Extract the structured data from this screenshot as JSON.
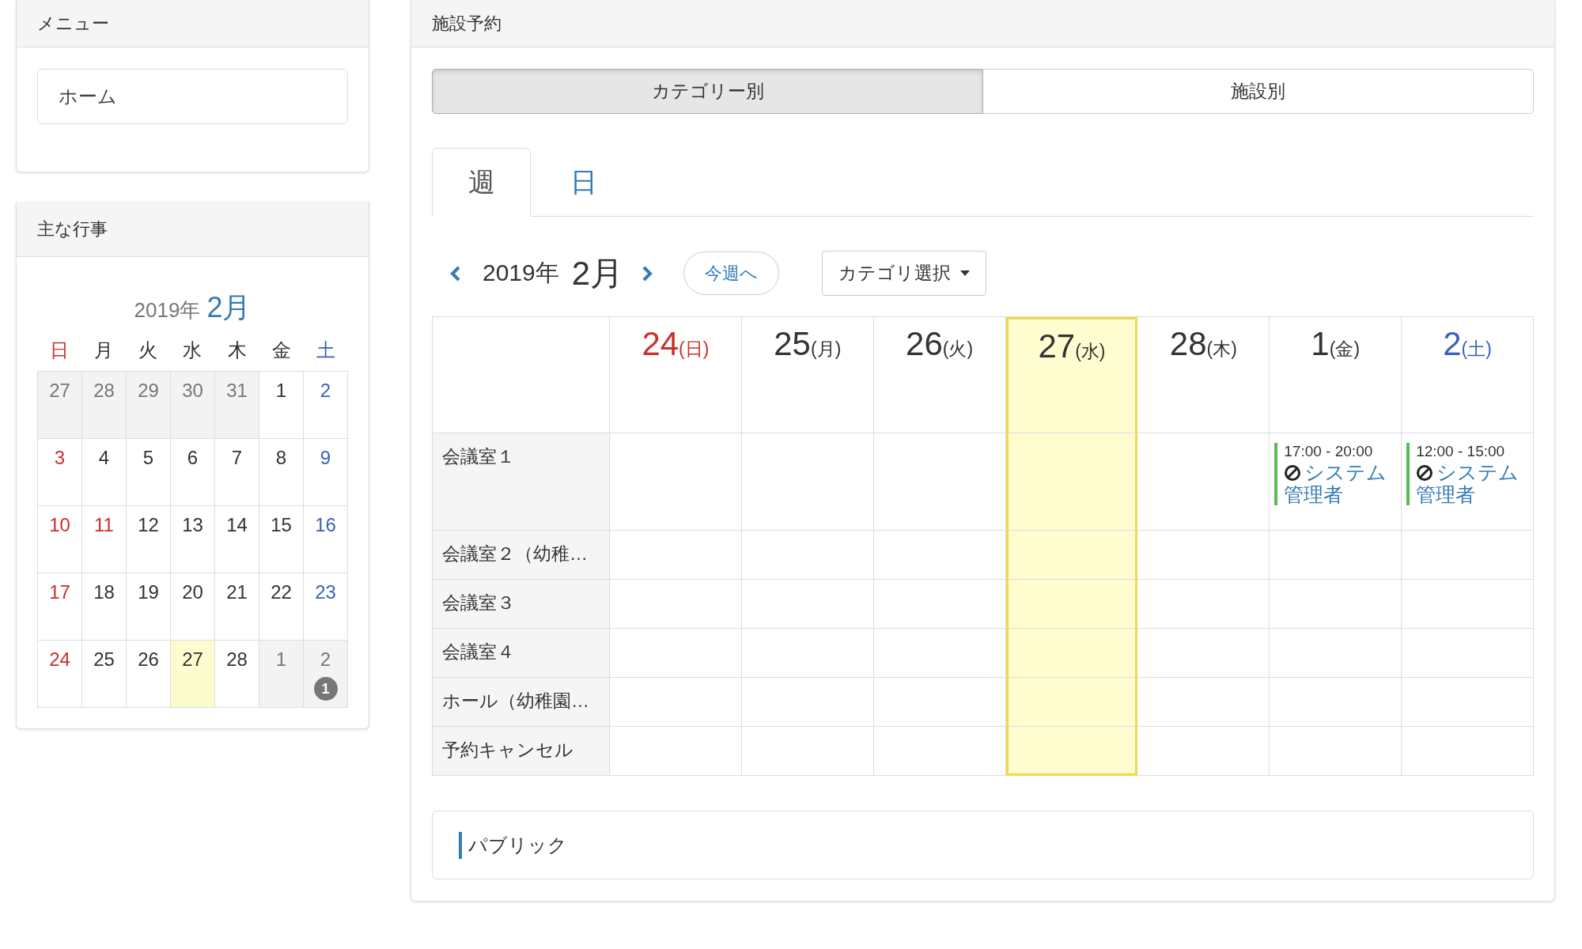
{
  "menu_panel": {
    "title": "メニュー",
    "items": [
      {
        "label": "ホーム"
      }
    ]
  },
  "events_panel": {
    "title": "主な行事",
    "calendar": {
      "year": "2019年",
      "month": "2月",
      "weekdays": [
        {
          "label": "日",
          "kind": "sun"
        },
        {
          "label": "月",
          "kind": "normal"
        },
        {
          "label": "火",
          "kind": "normal"
        },
        {
          "label": "水",
          "kind": "normal"
        },
        {
          "label": "木",
          "kind": "normal"
        },
        {
          "label": "金",
          "kind": "normal"
        },
        {
          "label": "土",
          "kind": "sat"
        }
      ],
      "weeks": [
        [
          {
            "day": "27",
            "kind": "other",
            "today": false
          },
          {
            "day": "28",
            "kind": "other",
            "today": false
          },
          {
            "day": "29",
            "kind": "other",
            "today": false
          },
          {
            "day": "30",
            "kind": "other",
            "today": false
          },
          {
            "day": "31",
            "kind": "other",
            "today": false
          },
          {
            "day": "1",
            "kind": "normal",
            "today": false
          },
          {
            "day": "2",
            "kind": "sat",
            "today": false
          }
        ],
        [
          {
            "day": "3",
            "kind": "sun",
            "today": false
          },
          {
            "day": "4",
            "kind": "normal",
            "today": false
          },
          {
            "day": "5",
            "kind": "normal",
            "today": false
          },
          {
            "day": "6",
            "kind": "normal",
            "today": false
          },
          {
            "day": "7",
            "kind": "normal",
            "today": false
          },
          {
            "day": "8",
            "kind": "normal",
            "today": false
          },
          {
            "day": "9",
            "kind": "sat",
            "today": false
          }
        ],
        [
          {
            "day": "10",
            "kind": "sun",
            "today": false
          },
          {
            "day": "11",
            "kind": "holiday",
            "today": false
          },
          {
            "day": "12",
            "kind": "normal",
            "today": false
          },
          {
            "day": "13",
            "kind": "normal",
            "today": false
          },
          {
            "day": "14",
            "kind": "normal",
            "today": false
          },
          {
            "day": "15",
            "kind": "normal",
            "today": false
          },
          {
            "day": "16",
            "kind": "sat",
            "today": false
          }
        ],
        [
          {
            "day": "17",
            "kind": "sun",
            "today": false
          },
          {
            "day": "18",
            "kind": "normal",
            "today": false
          },
          {
            "day": "19",
            "kind": "normal",
            "today": false
          },
          {
            "day": "20",
            "kind": "normal",
            "today": false
          },
          {
            "day": "21",
            "kind": "normal",
            "today": false
          },
          {
            "day": "22",
            "kind": "normal",
            "today": false
          },
          {
            "day": "23",
            "kind": "sat",
            "today": false
          }
        ],
        [
          {
            "day": "24",
            "kind": "sun",
            "today": false
          },
          {
            "day": "25",
            "kind": "normal",
            "today": false
          },
          {
            "day": "26",
            "kind": "normal",
            "today": false
          },
          {
            "day": "27",
            "kind": "normal",
            "today": true
          },
          {
            "day": "28",
            "kind": "normal",
            "today": false
          },
          {
            "day": "1",
            "kind": "other",
            "today": false
          },
          {
            "day": "2",
            "kind": "other",
            "today": false,
            "badge": "1"
          }
        ]
      ]
    }
  },
  "reservation_panel": {
    "title": "施設予約",
    "view_toggle": [
      {
        "label": "カテゴリー別",
        "selected": true
      },
      {
        "label": "施設別",
        "selected": false
      }
    ],
    "tabs": [
      {
        "label": "週",
        "selected": true
      },
      {
        "label": "日",
        "selected": false
      }
    ],
    "nav": {
      "year": "2019年",
      "month": "2月",
      "this_week_button": "今週へ",
      "category_dropdown": "カテゴリ選択"
    },
    "schedule": {
      "days": [
        {
          "date": "24",
          "weekday": "(日)",
          "kind": "sun",
          "today": false
        },
        {
          "date": "25",
          "weekday": "(月)",
          "kind": "normal",
          "today": false
        },
        {
          "date": "26",
          "weekday": "(火)",
          "kind": "normal",
          "today": false
        },
        {
          "date": "27",
          "weekday": "(水)",
          "kind": "normal",
          "today": true
        },
        {
          "date": "28",
          "weekday": "(木)",
          "kind": "normal",
          "today": false
        },
        {
          "date": "1",
          "weekday": "(金)",
          "kind": "normal",
          "today": false
        },
        {
          "date": "2",
          "weekday": "(土)",
          "kind": "sat",
          "today": false
        }
      ],
      "rows": [
        {
          "facility": "会議室１",
          "cells": [
            {},
            {},
            {},
            {},
            {},
            {
              "booking": {
                "time": "17:00 - 20:00",
                "user": "システム管理者"
              }
            },
            {
              "booking": {
                "time": "12:00 - 15:00",
                "user": "システム管理者"
              }
            }
          ]
        },
        {
          "facility": "会議室２（幼稚…",
          "cells": [
            {},
            {},
            {},
            {},
            {},
            {},
            {}
          ]
        },
        {
          "facility": "会議室３",
          "cells": [
            {},
            {},
            {},
            {},
            {},
            {},
            {}
          ]
        },
        {
          "facility": "会議室４",
          "cells": [
            {},
            {},
            {},
            {},
            {},
            {},
            {}
          ]
        },
        {
          "facility": "ホール（幼稚園…",
          "cells": [
            {},
            {},
            {},
            {},
            {},
            {},
            {}
          ]
        },
        {
          "facility": "予約キャンセル",
          "cells": [
            {},
            {},
            {},
            {},
            {},
            {},
            {}
          ]
        }
      ]
    },
    "public_section": {
      "label": "パブリック"
    }
  }
}
